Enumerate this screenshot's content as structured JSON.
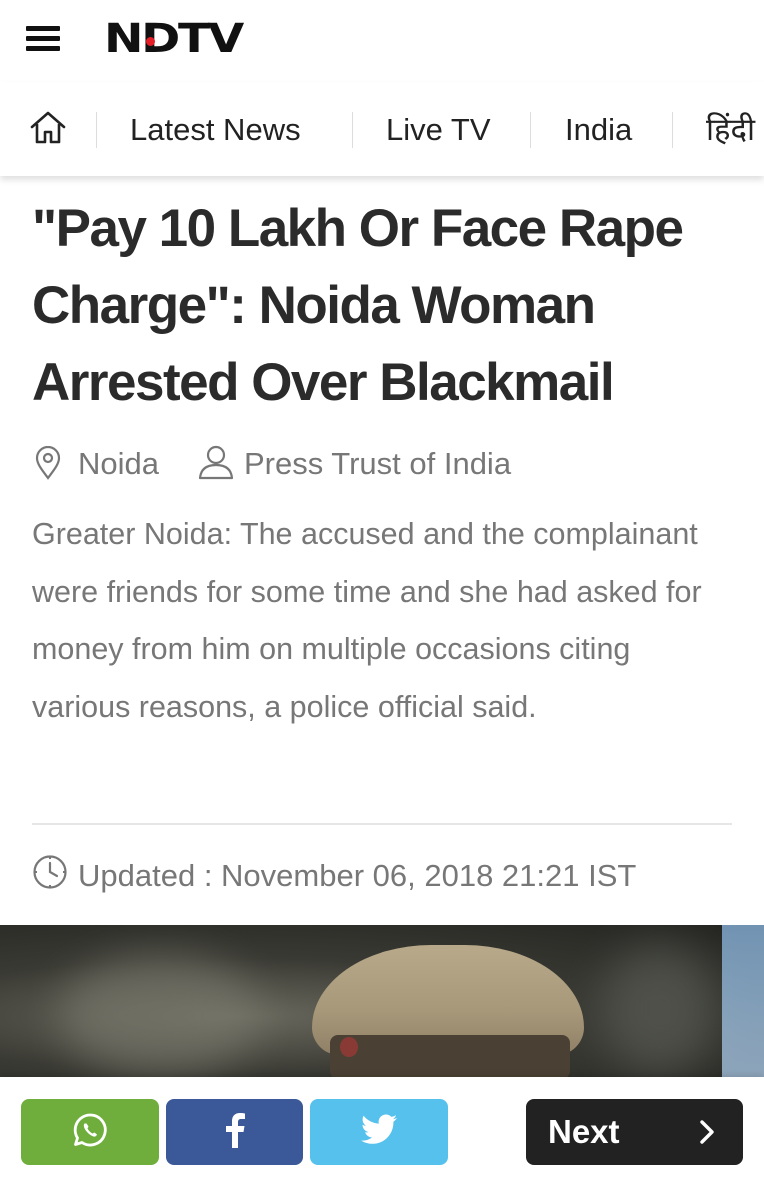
{
  "header": {
    "logo_text": "NDTV",
    "brand_color": "#e41e26"
  },
  "nav": {
    "items": [
      {
        "label": "Latest News"
      },
      {
        "label": "Live TV"
      },
      {
        "label": "India"
      },
      {
        "label": "हिंदी"
      }
    ]
  },
  "article": {
    "headline": "\"Pay 10 Lakh Or Face Rape Charge\": Noida Woman Arrested Over Blackmail",
    "location": "Noida",
    "author": "Press Trust of India",
    "summary": "Greater Noida: The accused and the complainant were friends for some time and she had asked for money from him on multiple occasions citing various reasons, a police official said.",
    "updated": "Updated : November 06, 2018 21:21 IST"
  },
  "sharebar": {
    "whatsapp_color": "#6fae3c",
    "facebook_color": "#3b5998",
    "twitter_color": "#55c1ec",
    "next_label": "Next"
  }
}
